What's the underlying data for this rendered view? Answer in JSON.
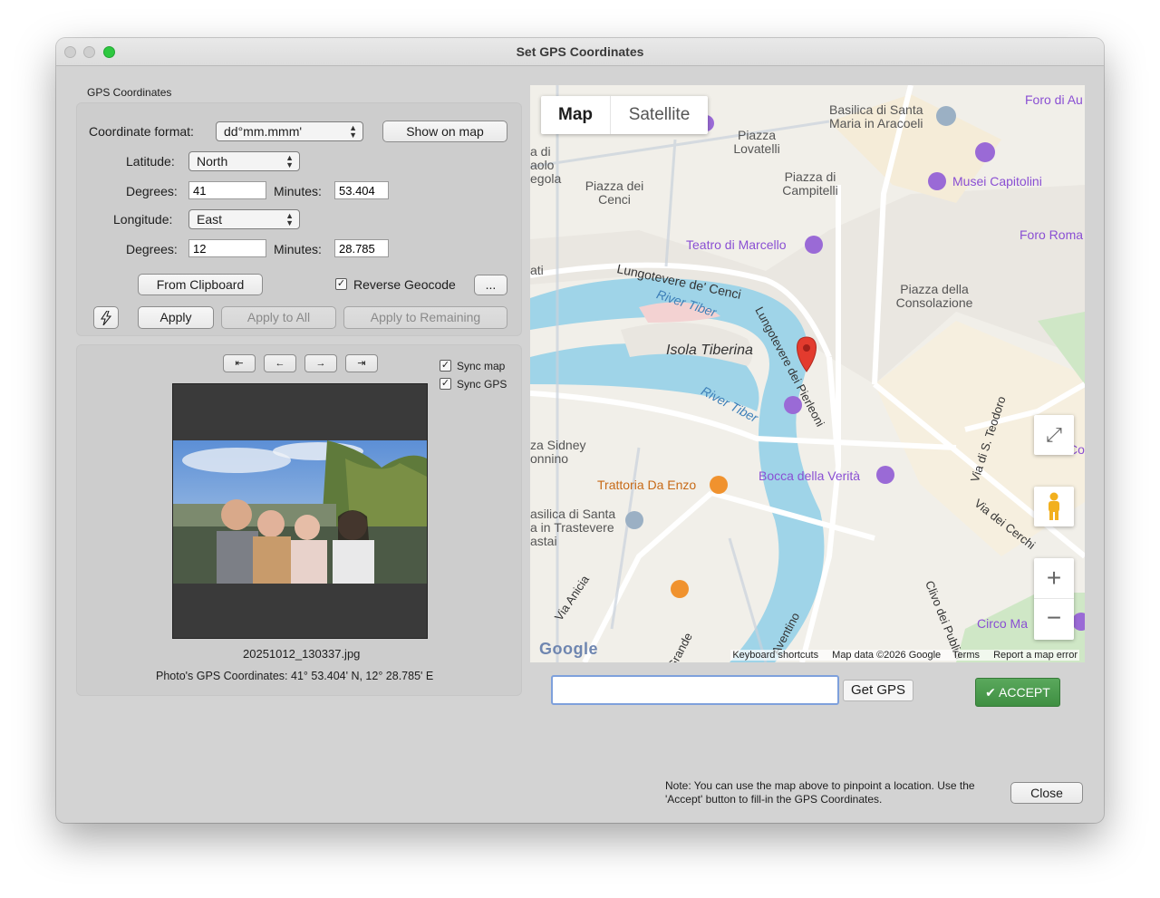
{
  "window": {
    "title": "Set GPS Coordinates"
  },
  "gps_panel": {
    "group_label": "GPS Coordinates",
    "coordinate_format_label": "Coordinate format:",
    "coordinate_format_value": "dd°mm.mmm'",
    "show_on_map": "Show on map",
    "latitude_label": "Latitude:",
    "latitude_value": "North",
    "lat_degrees_label": "Degrees:",
    "lat_degrees": "41",
    "lat_minutes_label": "Minutes:",
    "lat_minutes": "53.404",
    "longitude_label": "Longitude:",
    "longitude_value": "East",
    "lon_degrees_label": "Degrees:",
    "lon_degrees": "12",
    "lon_minutes_label": "Minutes:",
    "lon_minutes": "28.785",
    "from_clipboard": "From Clipboard",
    "reverse_geocode_label": "Reverse Geocode",
    "reverse_geocode_checked": true,
    "more_button": "...",
    "apply": "Apply",
    "apply_all": "Apply to All",
    "apply_remaining": "Apply to Remaining"
  },
  "photo_panel": {
    "sync_map_label": "Sync map",
    "sync_gps_label": "Sync GPS",
    "filename": "20251012_130337.jpg",
    "photo_gps": "Photo's GPS Coordinates: 41° 53.404' N, 12° 28.785' E"
  },
  "map": {
    "tab_map": "Map",
    "tab_satellite": "Satellite",
    "labels": {
      "basilica_aracoeli": "Basilica di Santa Maria in Aracoeli",
      "foro_au": "Foro di Au",
      "piazza_lovatelli": "Piazza Lovatelli",
      "piazza_campitelli": "Piazza di Campitelli",
      "piazza_cenci": "Piazza dei Cenci",
      "musei_capitolini": "Musei Capitolini",
      "teatro_marcello": "Teatro di Marcello",
      "foro_roma": "Foro Roma",
      "lungotevere_cenci": "Lungotevere de' Cenci",
      "river_tiber_1": "River Tiber",
      "river_tiber_2": "River Tiber",
      "isola_tiberina": "Isola Tiberina",
      "piazza_consolazione": "Piazza della Consolazione",
      "pierleoni": "Lungotevere dei Pierleoni",
      "sidney": "za Sidney onnino",
      "trattoria": "Trattoria Da Enzo",
      "bocca": "Bocca della Verità",
      "basilica_trastevere": "asilica di Santa a in Trastevere astai",
      "via_teodoro": "Via di S. Teodoro",
      "via_cerchi": "Via dei Cerchi",
      "via_anicia": "Via Anicia",
      "aventino": "Aventino",
      "clivo_publici": "Clivo dei Publici",
      "circo_ma": "Circo Ma",
      "grande": "Grande",
      "left_edge": "a di aolo egola",
      "ati": "ati",
      "co": "Co"
    },
    "footer_shortcuts": "Keyboard shortcuts",
    "footer_data": "Map data ©2026 Google",
    "footer_terms": "Terms",
    "footer_report": "Report a map error",
    "google": "Google"
  },
  "bottom": {
    "search_value": "",
    "get_gps": "Get GPS",
    "accept": "ACCEPT",
    "note": "Note: You can use the map above to pinpoint a location.  Use the 'Accept' button to fill-in the GPS Coordinates.",
    "close": "Close"
  },
  "colors": {
    "accept_green": "#4a9c4c",
    "window_bg": "#d3d3d3",
    "map_water": "#9fd4e8",
    "map_bg": "#f1efe9",
    "pin_red": "#e33b2e"
  }
}
